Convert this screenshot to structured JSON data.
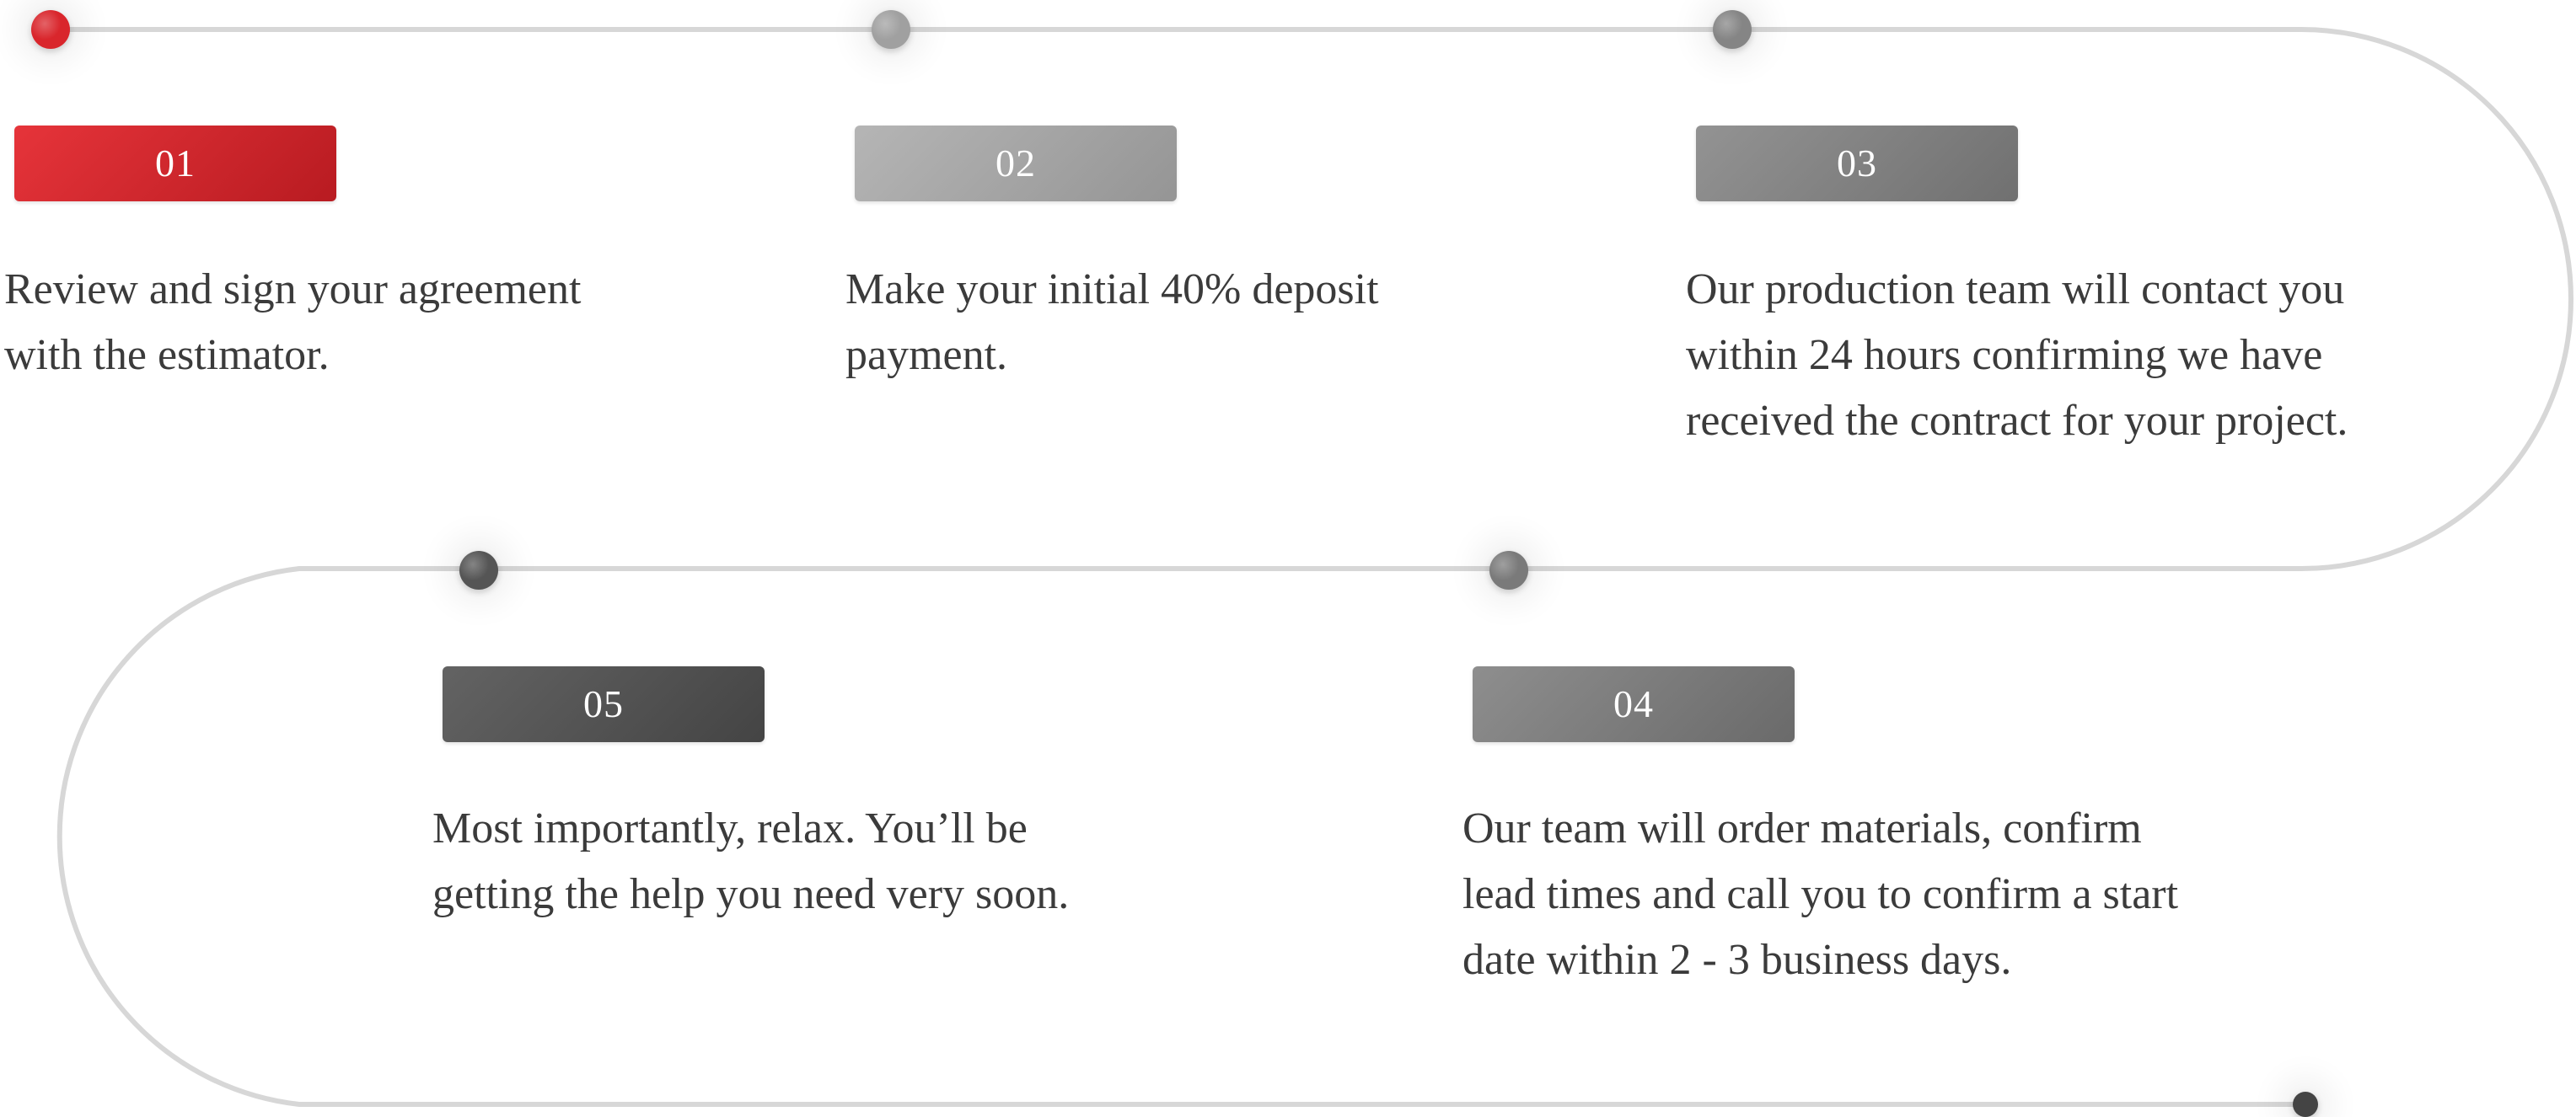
{
  "colors": {
    "path": "#d7d7d7",
    "text": "#3b3b3b",
    "active": "#d9262c",
    "badge_text": "#ffffff"
  },
  "steps": [
    {
      "number": "01",
      "lines": [
        "Review and sign your agreement",
        "with the estimator."
      ],
      "state": "active",
      "badge_gradient": [
        "#e6343a",
        "#b81b21"
      ],
      "dot_color": "#d9262c"
    },
    {
      "number": "02",
      "lines": [
        "Make your initial 40% deposit",
        "payment."
      ],
      "state": "pending",
      "badge_gradient": [
        "#b5b5b5",
        "#959595"
      ],
      "dot_color": "#a0a0a0"
    },
    {
      "number": "03",
      "lines": [
        "Our  production team will contact you",
        "within 24 hours confirming we have",
        "received the contract for your project."
      ],
      "state": "pending",
      "badge_gradient": [
        "#939393",
        "#707070"
      ],
      "dot_color": "#858585"
    },
    {
      "number": "04",
      "lines": [
        "Our team will order materials, confirm",
        "lead times and call you to confirm a start",
        "date within 2 - 3 business days."
      ],
      "state": "pending",
      "badge_gradient": [
        "#8e8e8e",
        "#6a6a6a"
      ],
      "dot_color": "#7a7a7a"
    },
    {
      "number": "05",
      "lines": [
        "Most importantly, relax. You’ll be",
        "getting the help you need very soon."
      ],
      "state": "pending",
      "badge_gradient": [
        "#636363",
        "#444444"
      ],
      "dot_color": "#555555"
    }
  ],
  "end_marker": {
    "dot_color": "#444444"
  }
}
